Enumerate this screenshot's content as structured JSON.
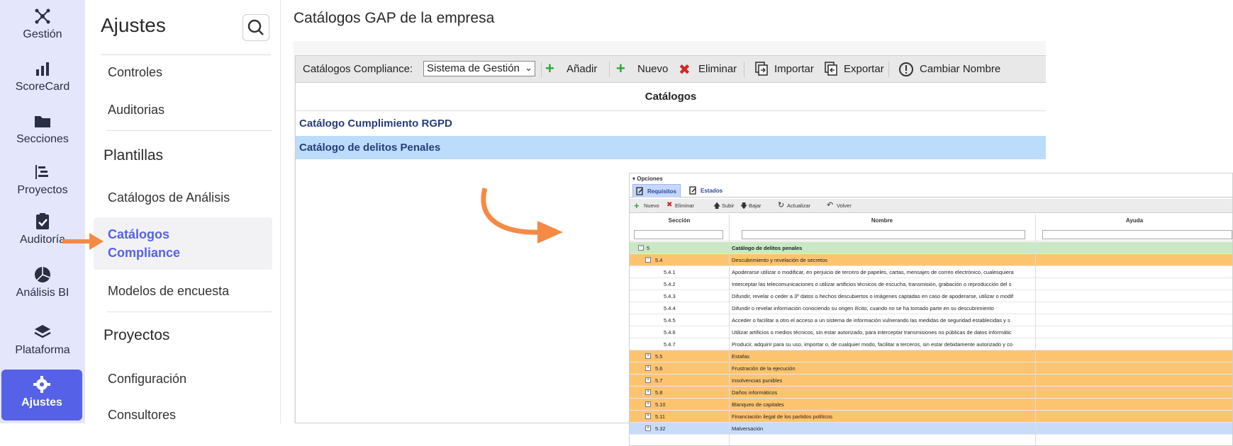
{
  "rail": {
    "items": [
      {
        "label": "Gestión",
        "icon": "network-icon"
      },
      {
        "label": "ScoreCard",
        "icon": "bar-chart-icon"
      },
      {
        "label": "Secciones",
        "icon": "folder-icon"
      },
      {
        "label": "Proyectos",
        "icon": "gantt-icon"
      },
      {
        "label": "Auditoría",
        "icon": "clipboard-check-icon"
      },
      {
        "label": "Análisis BI",
        "icon": "pie-chart-icon"
      },
      {
        "label": "Plataforma",
        "icon": "layers-icon"
      },
      {
        "label": "Ajustes",
        "icon": "gear-icon"
      }
    ]
  },
  "panel": {
    "title": "Ajustes",
    "links": {
      "controles": "Controles",
      "auditorias": "Auditorias",
      "catalogos_analisis": "Catálogos de Análisis",
      "catalogos_compliance_1": "Catálogos",
      "catalogos_compliance_2": "Compliance",
      "modelos_encuesta": "Modelos de encuesta",
      "configuracion": "Configuración",
      "consultores": "Consultores"
    },
    "headings": {
      "plantillas": "Plantillas",
      "proyectos": "Proyectos"
    }
  },
  "main": {
    "title": "Catálogos GAP de la empresa",
    "toolbar": {
      "select_label": "Catálogos Compliance:",
      "select_value": "Sistema de Gestión",
      "add": "Añadir",
      "new": "Nuevo",
      "delete": "Eliminar",
      "import": "Importar",
      "export": "Exportar",
      "rename": "Cambiar Nombre"
    },
    "column_header": "Catálogos",
    "rows": [
      "Catálogo Cumplimiento RGPD",
      "Catálogo de delitos Penales"
    ]
  },
  "overlay": {
    "options_label": "Opciones",
    "tabs": [
      "Requisitos",
      "Estados"
    ],
    "toolbar": {
      "new": "Nuevo",
      "delete": "Eliminar",
      "up": "Subir",
      "down": "Bajar",
      "refresh": "Actualizar",
      "back": "Volver"
    },
    "columns": [
      "Sección",
      "Nombre",
      "Ayuda"
    ],
    "rows": [
      {
        "sec": "5",
        "name": "Catálogo de delitos penales",
        "style": "green",
        "exp": "⊟"
      },
      {
        "sec": "5.4",
        "name": "Descubrimiento y revelación de secretos",
        "style": "orange",
        "exp": "⊟"
      },
      {
        "sec": "5.4.1",
        "name": "Apoderarse utilizar o modificar, en perjuicio de tercero de papeles, cartas, mensajes de correo electrónico, cualesquiera",
        "style": "",
        "exp": ""
      },
      {
        "sec": "5.4.2",
        "name": "Interceptar las telecomunicaciones o utilizar artificios técnicos de escucha, transmisión, grabación o reproducción del s",
        "style": "",
        "exp": ""
      },
      {
        "sec": "5.4.3",
        "name": "Difundir, revelar o ceder a 3º datos o hechos descubiertos o imágenes captadas en caso de apoderarse, utilizar o modif",
        "style": "",
        "exp": ""
      },
      {
        "sec": "5.4.4",
        "name": "Difundir o revelar información conociendo su origen ilícito, cuando no se ha tomado parte en su descubrimiento",
        "style": "",
        "exp": ""
      },
      {
        "sec": "5.4.5",
        "name": "Acceder o facilitar a otro el acceso a un sistema de información vulnerando las medidas de seguridad establecidas y s",
        "style": "",
        "exp": ""
      },
      {
        "sec": "5.4.6",
        "name": "Utilizar artificios o medios técnicos, sin estar autorizado, para interceptar transmisiones no públicas de datos informátic",
        "style": "",
        "exp": ""
      },
      {
        "sec": "5.4.7",
        "name": "Producir, adquirir para su uso, importar o, de cualquier modo, facilitar a terceros, sin estar debidamente autorizado y co",
        "style": "",
        "exp": ""
      },
      {
        "sec": "5.5",
        "name": "Estafas",
        "style": "orange",
        "exp": "⊞"
      },
      {
        "sec": "5.6",
        "name": "Frustración de la ejecución",
        "style": "orange",
        "exp": "⊞"
      },
      {
        "sec": "5.7",
        "name": "Insolvencias punibles",
        "style": "orange",
        "exp": "⊞"
      },
      {
        "sec": "5.8",
        "name": "Daños informáticos",
        "style": "orange",
        "exp": "⊞"
      },
      {
        "sec": "5.10",
        "name": "Blanqueo de capitales",
        "style": "orange",
        "exp": "⊞"
      },
      {
        "sec": "5.11",
        "name": "Financiación ilegal de los partidos políticos",
        "style": "orange",
        "exp": "⊞"
      },
      {
        "sec": "5.32",
        "name": "Malversación",
        "style": "blue",
        "exp": "⊞"
      }
    ]
  },
  "colors": {
    "rail_bg": "#e4e6fb",
    "accent": "#5562e8",
    "selected_row": "#bcdcfb",
    "orange_row": "#fdc470",
    "green_row": "#c9e8c3",
    "arrow": "#f58a45"
  }
}
